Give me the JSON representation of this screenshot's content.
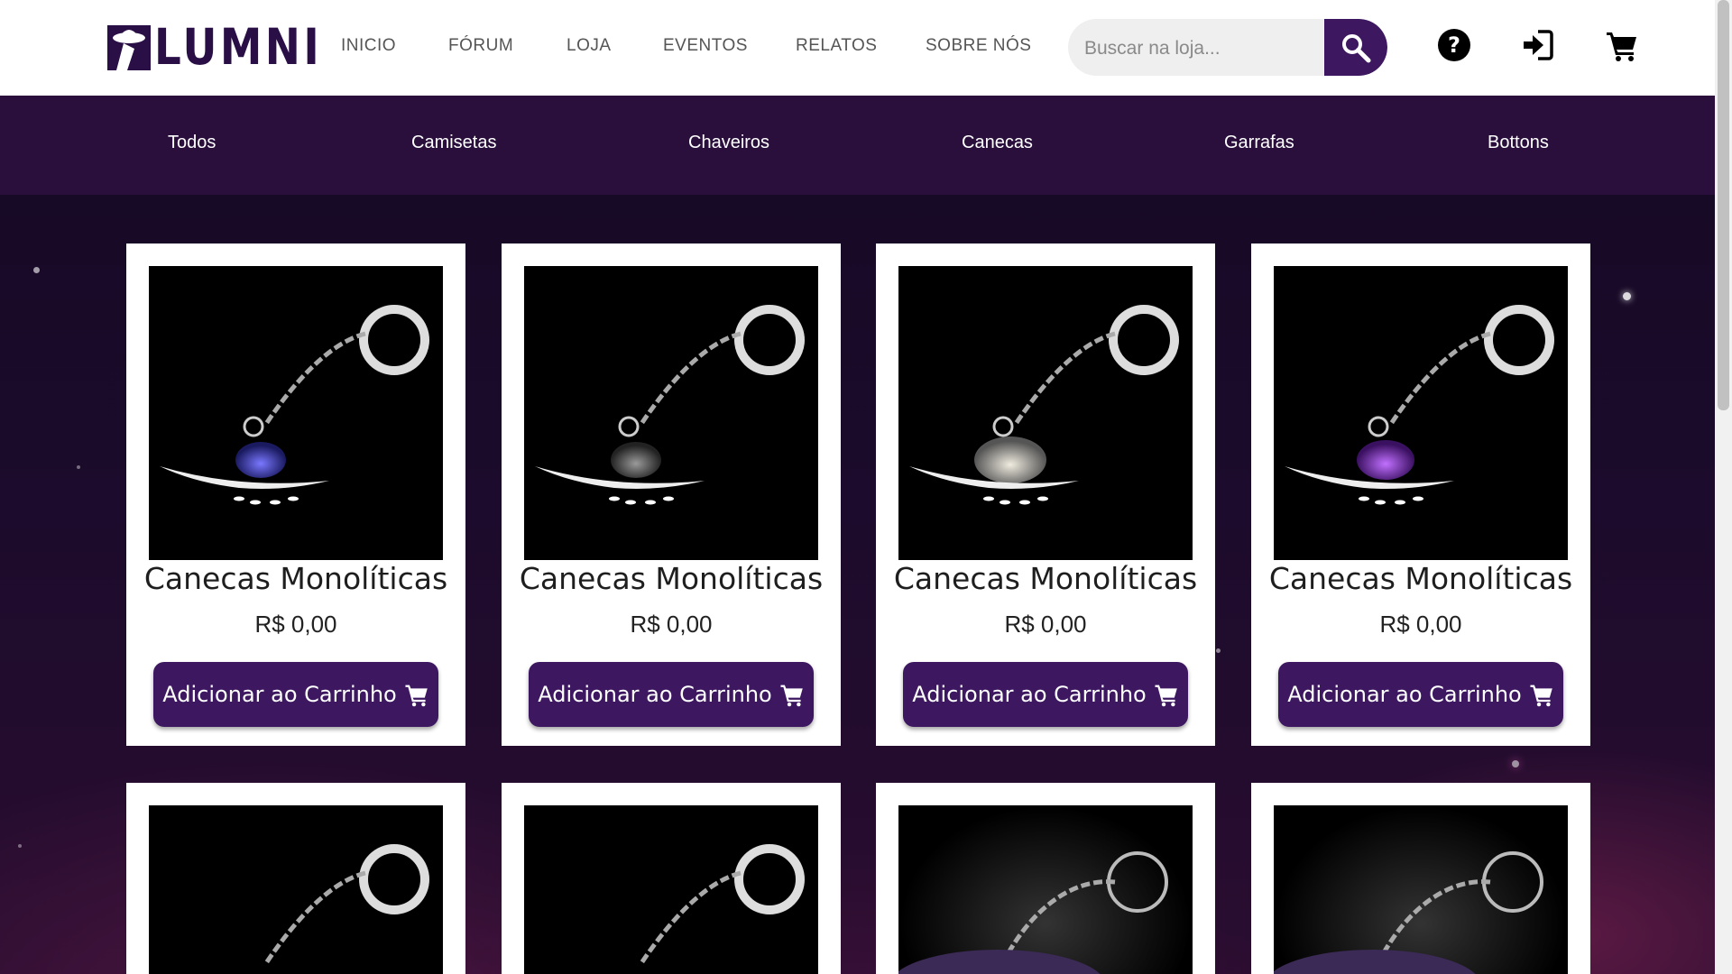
{
  "brand": {
    "logo_text": "LUMNI",
    "color": "#2a0f46"
  },
  "nav": [
    {
      "label": "INICIO"
    },
    {
      "label": "FÓRUM"
    },
    {
      "label": "LOJA"
    },
    {
      "label": "EVENTOS"
    },
    {
      "label": "RELATOS"
    },
    {
      "label": "SOBRE NÓS"
    }
  ],
  "search": {
    "placeholder": "Buscar na loja...",
    "icon": "search-icon"
  },
  "header_icons": [
    "help-icon",
    "login-icon",
    "cart-icon"
  ],
  "categories": [
    {
      "label": "Todos"
    },
    {
      "label": "Camisetas"
    },
    {
      "label": "Chaveiros"
    },
    {
      "label": "Canecas"
    },
    {
      "label": "Garrafas"
    },
    {
      "label": "Bottons"
    }
  ],
  "products": [
    {
      "name": "Canecas Monolíticas",
      "price": "R$ 0,00",
      "button": "Adicionar ao Carrinho",
      "glow": "#5a55d8"
    },
    {
      "name": "Canecas Monolíticas",
      "price": "R$ 0,00",
      "button": "Adicionar ao Carrinho",
      "glow": "#9a9a9a"
    },
    {
      "name": "Canecas Monolíticas",
      "price": "R$ 0,00",
      "button": "Adicionar ao Carrinho",
      "glow": "#e8e4d8"
    },
    {
      "name": "Canecas Monolíticas",
      "price": "R$ 0,00",
      "button": "Adicionar ao Carrinho",
      "glow": "#b35ee8"
    }
  ],
  "colors": {
    "accent": "#3d1760",
    "category_bar": "#2a0f3d"
  }
}
